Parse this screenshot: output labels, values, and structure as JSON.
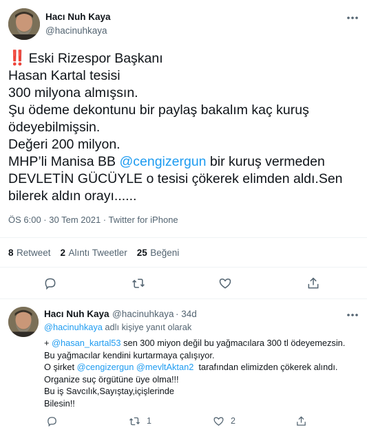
{
  "main_tweet": {
    "author_name": "Hacı Nuh Kaya",
    "author_handle": "@hacinuhkaya",
    "more_icon": "more-horizontal-icon",
    "emoji": "‼️",
    "lines": {
      "l1": "Eski Rizespor Başkanı",
      "l2": "Hasan Kartal tesisi",
      "l3": "300 milyona almışsın.",
      "l4": "Şu ödeme dekontunu bir paylaş bakalım kaç kuruş",
      "l5": "ödeyebilmişsin.",
      "l6": "Değeri 200 milyon.",
      "l7_pre": "MHP’li Manisa BB ",
      "l7_mention": "@cengizergun",
      "l7_post": " bir kuruş vermeden",
      "l8": "DEVLETİN GÜCÜYLE o tesisi çökerek elimden aldı.Sen",
      "l9": "bilerek aldın orayı......"
    },
    "timestamp": "ÖS 6:00 · 30 Tem 2021 · Twitter for iPhone",
    "stats": {
      "retweets_count": "8",
      "retweets_label": "Retweet",
      "quotes_count": "2",
      "quotes_label": "Alıntı Tweetler",
      "likes_count": "25",
      "likes_label": "Beğeni"
    }
  },
  "reply_tweet": {
    "author_name": "Hacı Nuh Kaya",
    "author_handle": "@hacinuhkaya",
    "time": "· 34d",
    "replying_to_handle": "@hacinuhkaya",
    "replying_to_suffix": " adlı kişiye yanıt olarak",
    "lines": {
      "r1_pre": "+ ",
      "r1_mention": "@hasan_kartal53",
      "r1_post": " sen 300 miyon değil bu yağmacılara 300 tl ödeyemezsin.",
      "r2": "Bu yağmacılar kendini kurtarmaya çalışıyor.",
      "r3_pre": "O şirket ",
      "r3_mention1": "@cengizergun",
      "r3_mid": " ",
      "r3_mention2": "@mevltAktan2",
      "r3_post": "  tarafından elimizden çökerek alındı.",
      "r4": "Organize suç örgütüne üye olma!!!",
      "r5": "Bu iş Savcılık,Sayıştay,içişlerinde",
      "r6": "Bilesin!!"
    },
    "retweet_count": "1",
    "like_count": "2"
  },
  "colors": {
    "link": "#1d9bf0",
    "secondary_text": "#536471",
    "primary_text": "#0f1419",
    "divider": "#eff3f4"
  }
}
